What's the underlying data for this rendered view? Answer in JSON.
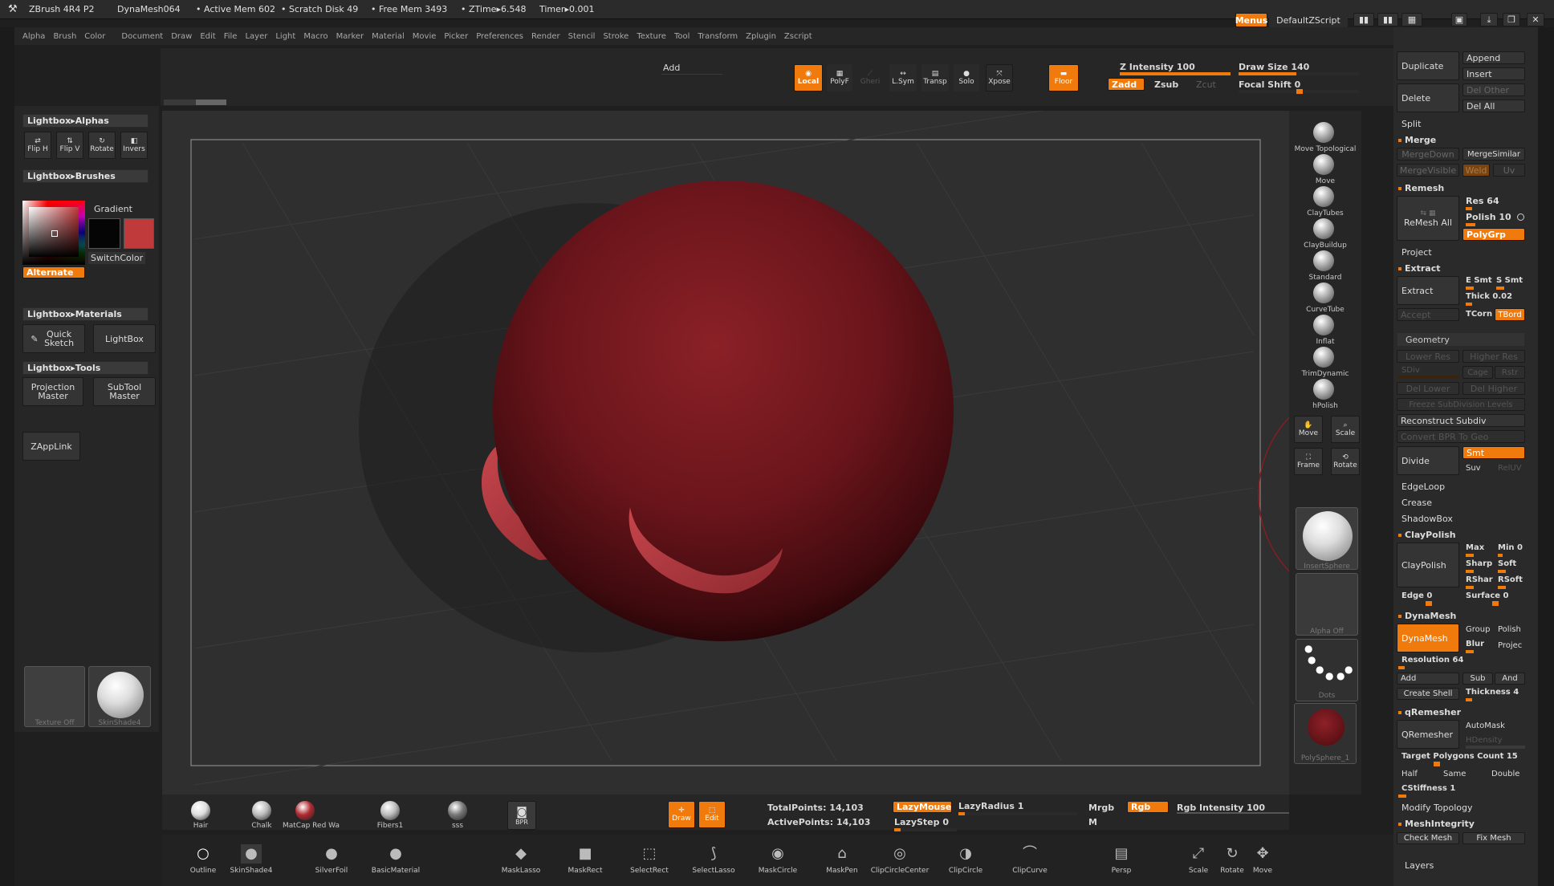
{
  "title_bar": {
    "app": "ZBrush 4R4 P2",
    "doc": "DynaMesh064",
    "active_mem": "• Active Mem 602",
    "scratch": "• Scratch Disk 49",
    "free_mem": "• Free Mem 3493",
    "ztime": "• ZTime▸6.548",
    "timer": "Timer▸0.001",
    "menus_btn": "Menus",
    "script": "DefaultZScript"
  },
  "menu_bar": [
    "Alpha",
    "Brush",
    "Color",
    "Document",
    "Draw",
    "Edit",
    "File",
    "Layer",
    "Light",
    "Macro",
    "Marker",
    "Material",
    "Movie",
    "Picker",
    "Preferences",
    "Render",
    "Stencil",
    "Stroke",
    "Texture",
    "Tool",
    "Transform",
    "Zplugin",
    "Zscript"
  ],
  "top_shelf": {
    "add_label": "Add",
    "buttons": [
      "Local",
      "PolyF",
      "Gheri",
      "L.Sym",
      "Transp",
      "Solo",
      "Xpose"
    ],
    "floor": "Floor",
    "zadd": "Zadd",
    "zsub": "Zsub",
    "zcut": "Zcut",
    "z_intensity": "Z Intensity 100",
    "draw_size": "Draw Size 140",
    "focal_shift": "Focal Shift 0",
    "z_intensity_value": 100,
    "draw_size_value": 140
  },
  "left_shelf": {
    "lb_alphas": "Lightbox▸Alphas",
    "alpha_btns": [
      "Flip H",
      "Flip V",
      "Rotate",
      "Invers"
    ],
    "lb_brushes": "Lightbox▸Brushes",
    "gradient": "Gradient",
    "switchcolor": "SwitchColor",
    "alternate": "Alternate",
    "lb_materials": "Lightbox▸Materials",
    "quick_sketch": "Quick Sketch",
    "lightbox": "LightBox",
    "lb_tools": "Lightbox▸Tools",
    "projection_master": "Projection Master",
    "subtool_master": "SubTool Master",
    "zapplink": "ZAppLink",
    "texture_off": "Texture Off",
    "skinshade": "SkinShade4",
    "main_color": "#c0393b"
  },
  "right_shelf": {
    "brushes": [
      "Move Topological",
      "Move",
      "ClayTubes",
      "ClayBuildup",
      "Standard",
      "CurveTube",
      "Inflat",
      "TrimDynamic",
      "hPolish"
    ],
    "nav": [
      "Move",
      "Scale",
      "Frame",
      "Rotate"
    ],
    "insert_sphere": "InsertSphere",
    "alpha_off": "Alpha Off",
    "dots": "Dots",
    "polysphere": "PolySphere_1"
  },
  "bottom_shelf": {
    "materials": [
      "Hair",
      "Chalk",
      "MatCap Red Wa",
      "Fibers1",
      "sss"
    ],
    "bpr": "BPR",
    "draw": "Draw",
    "edit": "Edit",
    "total_points": "TotalPoints: 14,103",
    "active_points": "ActivePoints: 14,103",
    "lazy_mouse": "LazyMouse",
    "lazy_radius": "LazyRadius 1",
    "lazy_step": "LazyStep 0",
    "mrgb": "Mrgb",
    "rgb": "Rgb",
    "m": "M",
    "rgb_intensity": "Rgb Intensity 100",
    "tools": [
      "Outline",
      "SkinShade4",
      "SilverFoil",
      "BasicMaterial",
      "MaskLasso",
      "MaskRect",
      "SelectRect",
      "SelectLasso",
      "MaskCircle",
      "MaskPen",
      "ClipCircleCenter",
      "ClipCircle",
      "ClipCurve",
      "Persp",
      "Scale",
      "Rotate",
      "Move"
    ]
  },
  "tool_panel": {
    "duplicate": "Duplicate",
    "append": "Append",
    "insert": "Insert",
    "delete": "Delete",
    "del_other": "Del Other",
    "del_all": "Del All",
    "split": "Split",
    "merge": "Merge",
    "merge_down": "MergeDown",
    "merge_similar": "MergeSimilar",
    "merge_visible": "MergeVisible",
    "weld": "Weld",
    "uv": "Uv",
    "remesh": "Remesh",
    "remesh_all": "ReMesh All",
    "res": "Res 64",
    "polish": "Polish 10",
    "polygrp": "PolyGrp",
    "project": "Project",
    "extract_hdr": "Extract",
    "extract": "Extract",
    "e_smt": "E Smt",
    "s_smt": "S Smt",
    "thick": "Thick 0.02",
    "accept": "Accept",
    "tcorn": "TCorn",
    "tbord": "TBord",
    "geometry": "Geometry",
    "lower_res": "Lower Res",
    "higher_res": "Higher Res",
    "sdiv": "SDiv",
    "cage": "Cage",
    "rstr": "Rstr",
    "del_lower": "Del Lower",
    "del_higher": "Del Higher",
    "freeze": "Freeze SubDivision Levels",
    "reconstruct": "Reconstruct Subdiv",
    "convert_bpr": "Convert BPR To Geo",
    "divide": "Divide",
    "smt": "Smt",
    "suv": "Suv",
    "reluv": "RelUV",
    "edgeloop": "EdgeLoop",
    "crease": "Crease",
    "shadowbox": "ShadowBox",
    "claypolish_hdr": "ClayPolish",
    "claypolish": "ClayPolish",
    "max": "Max",
    "min": "Min 0",
    "sharp": "Sharp",
    "soft": "Soft",
    "rshar": "RShar",
    "rsoft": "RSoft",
    "edge": "Edge 0",
    "surface": "Surface 0",
    "dynamesh_hdr": "DynaMesh",
    "dynamesh": "DynaMesh",
    "group": "Group",
    "polish2": "Polish",
    "blur": "Blur",
    "projec": "Projec",
    "resolution": "Resolution 64",
    "add": "Add",
    "sub": "Sub",
    "and": "And",
    "create_shell": "Create Shell",
    "thickness": "Thickness 4",
    "qremesher_hdr": "qRemesher",
    "qremesher": "QRemesher",
    "automask": "AutoMask",
    "hdensity": "HDensity",
    "target": "Target Polygons Count 15",
    "half": "Half",
    "same": "Same",
    "double": "Double",
    "cstiffness": "CStiffness 1",
    "modify_topology": "Modify Topology",
    "meshintegrity": "MeshIntegrity",
    "check_mesh": "Check Mesh",
    "fix_mesh": "Fix Mesh",
    "layers": "Layers"
  }
}
